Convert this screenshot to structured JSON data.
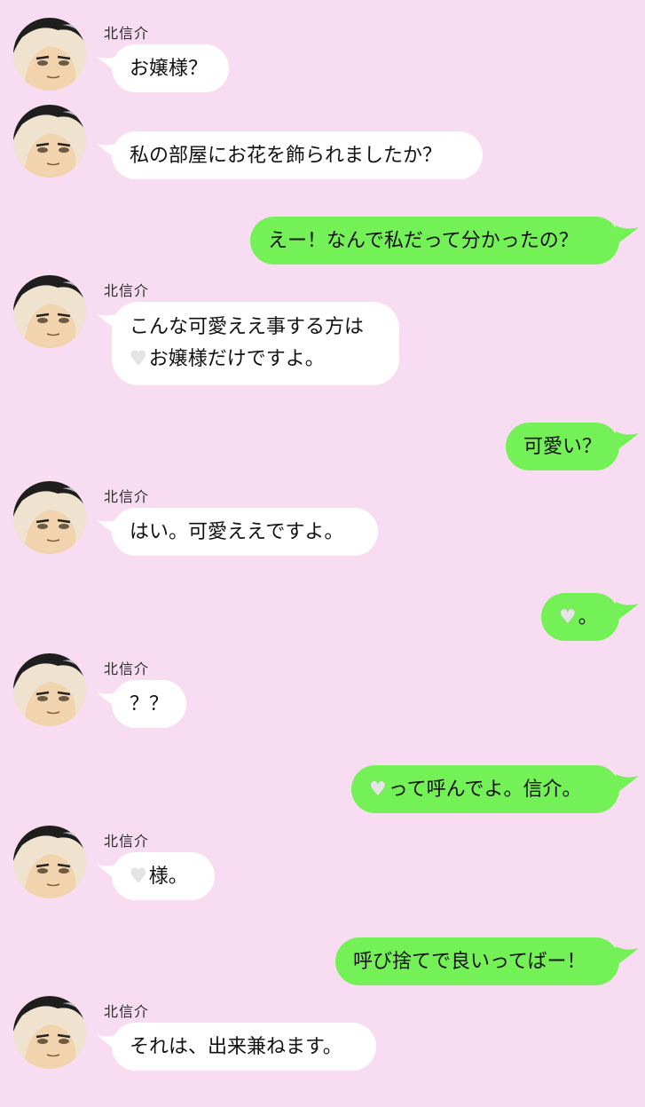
{
  "colors": {
    "background": "#f8dcf1",
    "incoming": "#ffffff",
    "outgoing": "#74f156"
  },
  "icons": {
    "avatar": "kita-shinsuke-avatar",
    "heart": "white-heart-emoji"
  },
  "messages": [
    {
      "sender": "北信介",
      "text": "お嬢様？"
    },
    {
      "text": "私の部屋にお花を飾られましたか？"
    },
    {
      "text": "えー！なんで私だって分かったの？"
    },
    {
      "sender": "北信介",
      "line1": "こんな可愛ええ事する方は",
      "line2": "お嬢様だけですよ。"
    },
    {
      "text": "可愛い？"
    },
    {
      "sender": "北信介",
      "text": "はい。可愛ええですよ。"
    },
    {
      "text": "。"
    },
    {
      "sender": "北信介",
      "text": "？？"
    },
    {
      "text": "って呼んでよ。信介。"
    },
    {
      "sender": "北信介",
      "text": "様。"
    },
    {
      "text": "呼び捨てで良いってばー！"
    },
    {
      "sender": "北信介",
      "text": "それは、出来兼ねます。"
    }
  ]
}
